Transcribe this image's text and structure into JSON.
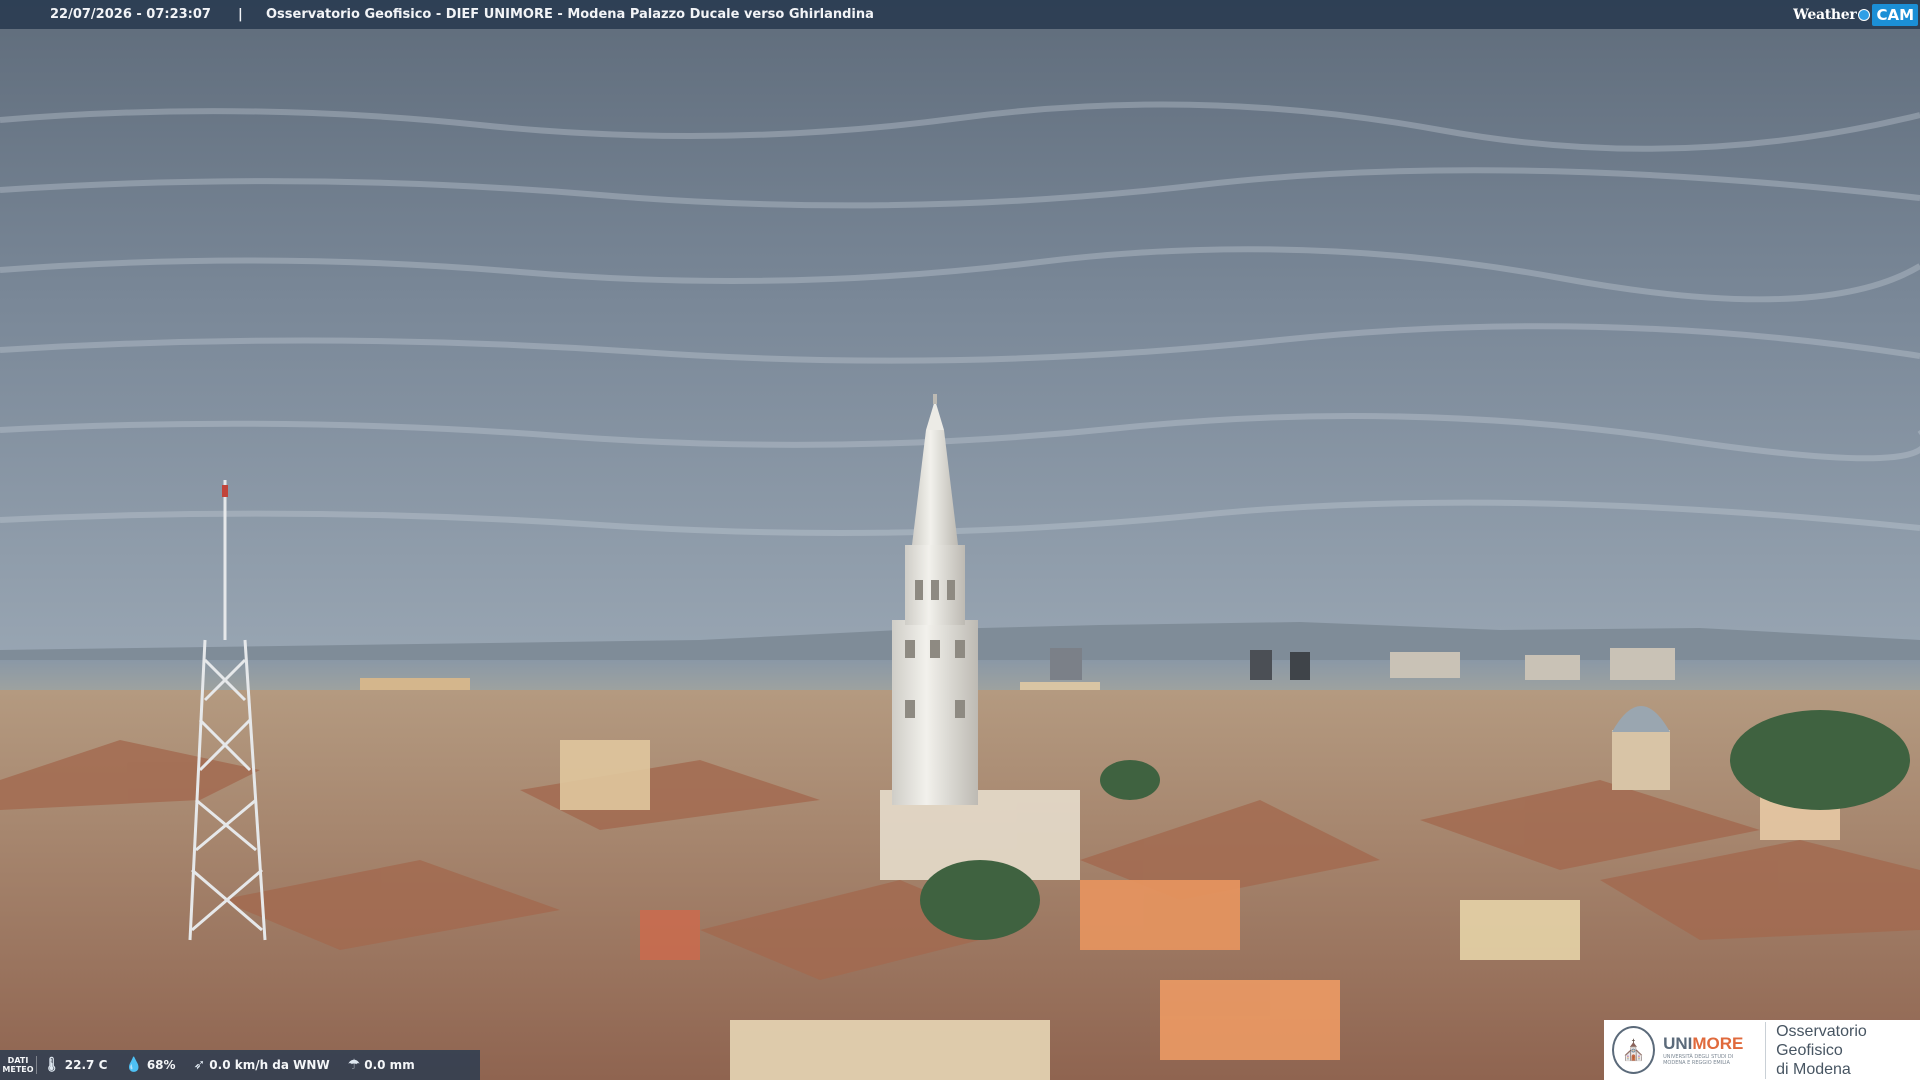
{
  "header": {
    "timestamp": "22/07/2026 - 07:23:07",
    "separator": "|",
    "title": "Osservatorio Geofisico - DIEF UNIMORE - Modena Palazzo Ducale verso Ghirlandina"
  },
  "brand": {
    "weather_label": "Weather",
    "cam_label": "CAM",
    "accent": "#1b8fd6"
  },
  "meteo": {
    "label": "DATI METEO",
    "temperature": "22.7 C",
    "humidity": "68%",
    "wind": "0.0 km/h da WNW",
    "rain": "0.0 mm",
    "icons": [
      "thermometer-icon",
      "humidity-drop-icon",
      "wind-icon",
      "rain-gauge-icon"
    ]
  },
  "logo": {
    "university_plain": "UNI",
    "university_accent": "MORE",
    "university_sub": "UNIVERSITÀ DEGLI STUDI DI MODENA E REGGIO EMILIA",
    "observatory_line1": "Osservatorio Geofisico",
    "observatory_line2": "di Modena",
    "accent": "#e06a3c"
  },
  "colors": {
    "sky_top": "#6d7b8a",
    "sky_bottom": "#8c9bab",
    "roof": "#b07a5c",
    "tower": "#e9e8e3"
  }
}
